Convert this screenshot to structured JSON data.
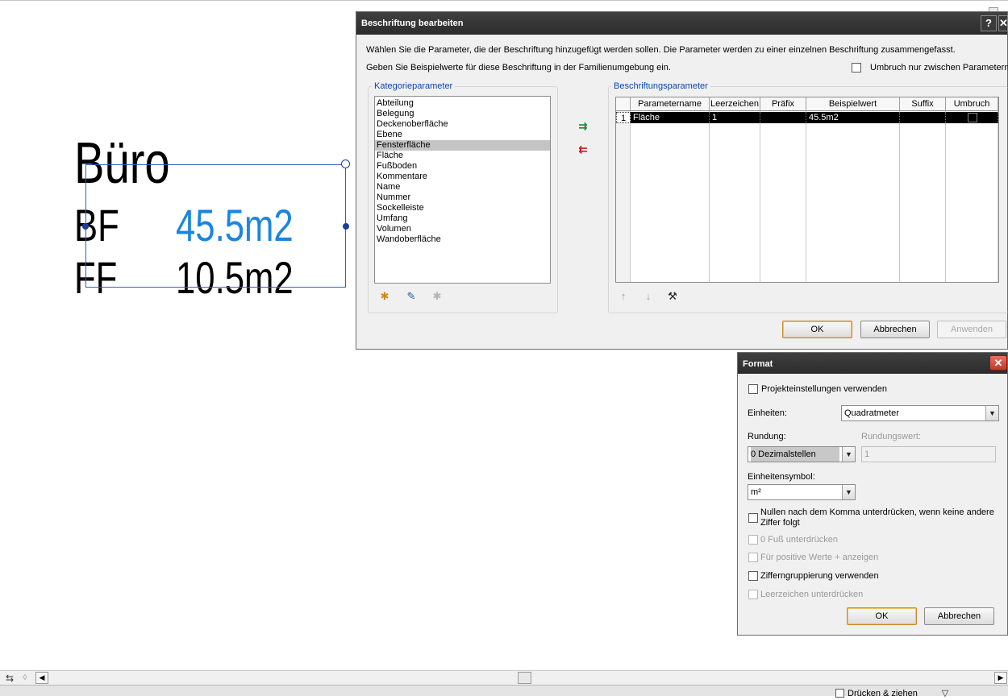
{
  "canvas": {
    "room_name": "Büro",
    "rows": [
      {
        "label": "BF",
        "value": "45.5m2",
        "value_color": "#1a86e0"
      },
      {
        "label": "FF",
        "value": "10.5m2",
        "value_color": "#000000"
      }
    ]
  },
  "edit_label_dialog": {
    "title": "Beschriftung bearbeiten",
    "help_glyph": "?",
    "close_glyph": "✕",
    "instruction_1": "Wählen Sie die Parameter, die der Beschriftung hinzugefügt werden sollen. Die Parameter werden zu einer einzelnen Beschriftung zusammengefasst.",
    "instruction_2": "Geben Sie Beispielwerte für diese Beschriftung in der Familienumgebung ein.",
    "wrap_checkbox_label": "Umbruch nur zwischen Parametern",
    "category_group_label": "Kategorieparameter",
    "category_items": [
      "Abteilung",
      "Belegung",
      "Deckenoberfläche",
      "Ebene",
      "Fensterfläche",
      "Fläche",
      "Fußboden",
      "Kommentare",
      "Name",
      "Nummer",
      "Sockelleiste",
      "Umfang",
      "Volumen",
      "Wandoberfläche"
    ],
    "selected_category": "Fensterfläche",
    "label_group_label": "Beschriftungsparameter",
    "columns": [
      "Parametername",
      "Leerzeichen",
      "Präfix",
      "Beispielwert",
      "Suffix",
      "Umbruch"
    ],
    "rows": [
      {
        "index": "1",
        "name": "Fläche",
        "spaces": "1",
        "prefix": "",
        "sample": "45.5m2",
        "suffix": "",
        "wrap": ""
      }
    ],
    "ok_label": "OK",
    "cancel_label": "Abbrechen",
    "apply_label": "Anwenden"
  },
  "format_dialog": {
    "title": "Format",
    "close_glyph": "✕",
    "use_project_settings": "Projekteinstellungen verwenden",
    "units_label": "Einheiten:",
    "units_value": "Quadratmeter",
    "rounding_label": "Rundung:",
    "rounding_value": "0 Dezimalstellen",
    "rounding_increment_label": "Rundungswert:",
    "rounding_increment_value": "1",
    "unit_symbol_label": "Einheitensymbol:",
    "unit_symbol_value": "m²",
    "suppress_trailing_zeros": "Nullen nach dem Komma unterdrücken, wenn keine andere Ziffer folgt",
    "suppress_zero_feet": "0 Fuß unterdrücken",
    "show_plus": "Für positive Werte + anzeigen",
    "digit_grouping": "Zifferngruppierung verwenden",
    "suppress_spaces": "Leerzeichen unterdrücken",
    "ok_label": "OK",
    "cancel_label": "Abbrechen"
  },
  "status_bar": {
    "drag_label": "Drücken & ziehen"
  },
  "colors": {
    "selected_value": "#1a86e0",
    "dialog_title_bg": "#333333",
    "group_label": "#0b47a8"
  }
}
